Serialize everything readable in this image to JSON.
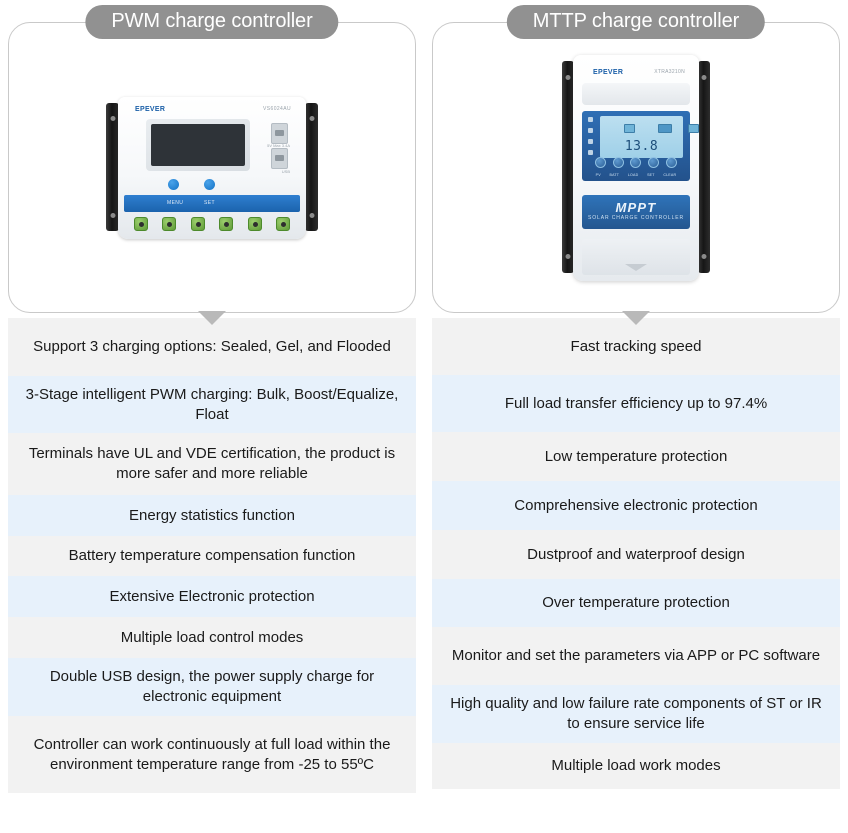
{
  "columns": [
    {
      "title": "PWM charge controller",
      "product": {
        "brand": "EPEVER",
        "model": "VS6024AU",
        "band_left_label": "MENU",
        "band_right_label": "SET",
        "usb_label_top": "5V  Max 3.4A",
        "usb_label_bottom": "USB"
      },
      "features": [
        "Support 3 charging options: Sealed, Gel, and Flooded",
        "3-Stage intelligent PWM charging: Bulk, Boost/Equalize, Float",
        "Terminals have UL and VDE certification, the product is more safer and more reliable",
        "Energy statistics function",
        "Battery temperature compensation function",
        "Extensive Electronic protection",
        "Multiple load control modes",
        "Double USB design, the power supply charge for electronic equipment",
        "Controller can work continuously at full load within the environment temperature range from -25 to 55ºC"
      ]
    },
    {
      "title": "MTTP charge controller",
      "product": {
        "brand": "EPEVER",
        "model": "XTRA3210N",
        "display_reading": "13.8",
        "logo_main": "MPPT",
        "logo_sub": "SOLAR CHARGE CONTROLLER",
        "key_labels": [
          "PV",
          "BATT",
          "LOAD",
          "SET",
          "CLEAR"
        ]
      },
      "features": [
        "Fast tracking speed",
        "Full load transfer efficiency up to 97.4%",
        "Low temperature protection",
        "Comprehensive electronic protection",
        "Dustproof and waterproof design",
        "Over temperature protection",
        "Monitor and set the parameters via APP or PC software",
        "High quality and low failure rate components of ST or IR to ensure service life",
        "Multiple load work modes"
      ]
    }
  ],
  "colors": {
    "title_pill": "#919191",
    "row_gray": "#f2f2f2",
    "row_blue": "#e7f1fb",
    "card_border": "#c9c9c9",
    "arrow": "#b9b9b9",
    "brand_blue": "#1b5fa8"
  }
}
